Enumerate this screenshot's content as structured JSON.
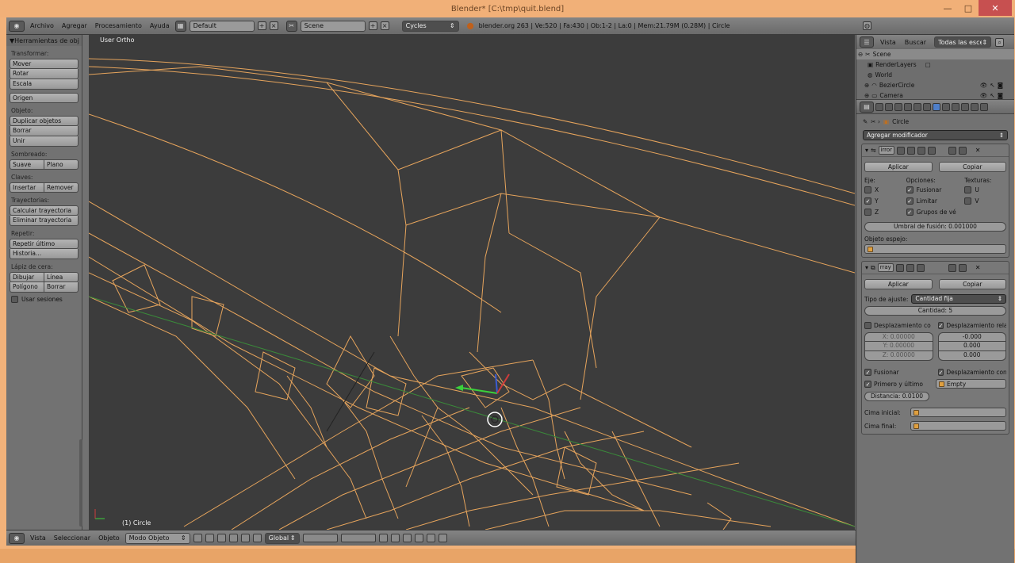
{
  "window": {
    "title": "Blender* [C:\\tmp\\quit.blend]",
    "minimize": "—",
    "maximize": "□",
    "close": "✕"
  },
  "topbar": {
    "menus": [
      "Archivo",
      "Agregar",
      "Procesamiento",
      "Ayuda"
    ],
    "layout": "Default",
    "scene": "Scene",
    "engine": "Cycles",
    "info": "blender.org 263 | Ve:520 | Fa:430 | Ob:1-2 | La:0 | Mem:21.79M (0.28M) | Circle"
  },
  "tools": {
    "header": "Herramientas de obj",
    "sec_transform": "Transformar:",
    "mover": "Mover",
    "rotar": "Rotar",
    "escala": "Escala",
    "origen": "Origen",
    "sec_objeto": "Objeto:",
    "duplicar": "Duplicar objetos",
    "borrar": "Borrar",
    "unir": "Unir",
    "sec_sombreado": "Sombreado:",
    "suave": "Suave",
    "plano": "Plano",
    "sec_claves": "Claves:",
    "insertar": "Insertar",
    "remover": "Remover",
    "sec_trayectorias": "Trayectorias:",
    "calc_tray": "Calcular trayectoria",
    "elim_tray": "Eliminar trayectoria",
    "sec_repetir": "Repetir:",
    "repetir_ultimo": "Repetir último",
    "historia": "Historia...",
    "sec_lapiz": "Lápiz de cera:",
    "dibujar": "Dibujar",
    "linea": "Línea",
    "poligono": "Polígono",
    "borrar2": "Borrar",
    "usar_sesiones": "Usar sesiones"
  },
  "viewport": {
    "label": "User Ortho",
    "object_label": "(1) Circle"
  },
  "bottombar": {
    "menus": [
      "Vista",
      "Seleccionar",
      "Objeto"
    ],
    "mode": "Modo Objeto",
    "orientation": "Global"
  },
  "outliner": {
    "vista": "Vista",
    "buscar": "Buscar",
    "filter": "Todas las escena",
    "items": [
      "Scene",
      "RenderLayers",
      "World",
      "BezierCircle",
      "Camera"
    ]
  },
  "properties": {
    "object_name": "Circle",
    "add_modifier": "Agregar modificador",
    "mirror": {
      "name": "irror",
      "aplicar": "Aplicar",
      "copiar": "Copiar",
      "eje": "Eje:",
      "opciones": "Opciones:",
      "texturas": "Texturas:",
      "x": "X",
      "y": "Y",
      "z": "Z",
      "fusionar": "Fusionar",
      "limitar": "Limitar",
      "grupos": "Grupos de vé",
      "u": "U",
      "v": "V",
      "umbral": "Umbral de fusión: 0.001000",
      "objeto_espejo": "Objeto espejo:"
    },
    "array": {
      "name": "rray",
      "aplicar": "Aplicar",
      "copiar": "Copiar",
      "tipo_ajuste": "Tipo de ajuste:",
      "tipo_value": "Cantidad fija",
      "cantidad": "Cantidad: 5",
      "desp_const": "Desplazamiento co",
      "desp_rel": "Desplazamiento rela",
      "x": "X: 0.00000",
      "y": "Y: 0.00000",
      "z": "Z: 0.00000",
      "rx": "-0.000",
      "ry": "0.000",
      "rz": "0.000",
      "fusionar": "Fusionar",
      "desp_obj": "Desplazamiento con",
      "primero": "Primero y último",
      "empty": "Empty",
      "distancia": "Distancia: 0.0100",
      "cima_inicial": "Cima inicial:",
      "cima_final": "Cima final:"
    }
  }
}
